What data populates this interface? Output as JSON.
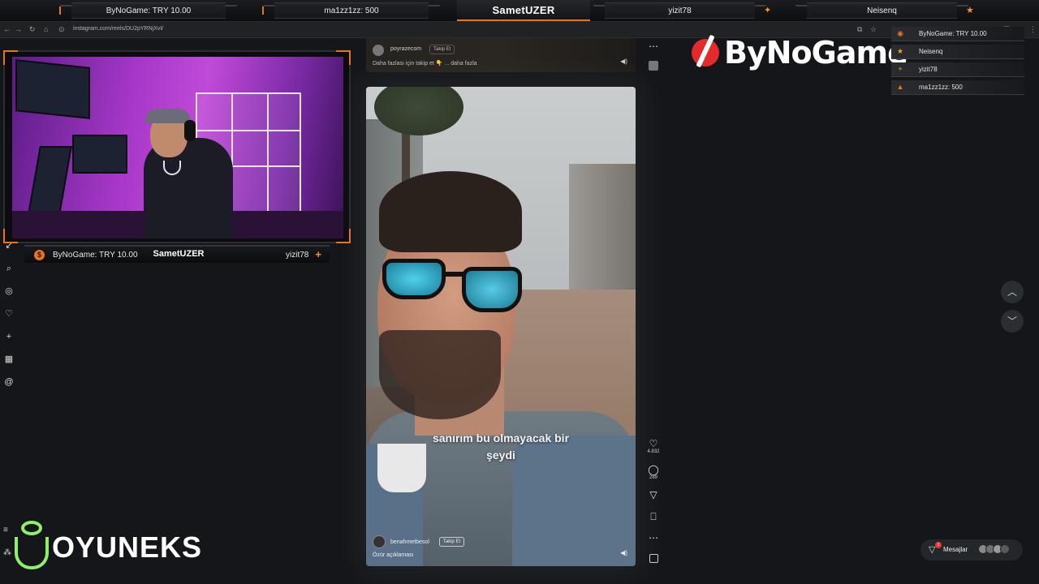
{
  "overlay": {
    "top_slots": [
      "ByNoGame: TRY 10.00",
      "ma1zz1zz: 500",
      "yizit78",
      "Neisenq"
    ],
    "streamer_name": "SametUZER",
    "cam_bar": {
      "left_label": "ByNoGame: TRY 10.00",
      "name": "SametUZER",
      "right_label": "yizit78",
      "coin_symbol": "$",
      "plus_symbol": "+"
    },
    "events": [
      {
        "icon": "coin-icon",
        "icon_glyph": "●",
        "color": "#e8741c",
        "label": "ByNoGame: TRY 10.00"
      },
      {
        "icon": "star-icon",
        "icon_glyph": "★",
        "color": "#f2a51e",
        "label": "Neisenq"
      },
      {
        "icon": "plus-icon",
        "icon_glyph": "+",
        "color": "#f2a51e",
        "label": "yizit78"
      },
      {
        "icon": "flame-icon",
        "icon_glyph": "▲",
        "color": "#e8741c",
        "label": "ma1zz1zz: 500"
      }
    ],
    "logo_text": "ByNoGame",
    "sponsor_text": "OYUNEKS",
    "accent_color": "#e8741c"
  },
  "browser": {
    "url": "instagram.com/reels/DU2pYRNjXvI/"
  },
  "top_post": {
    "username": "poyrazecom",
    "follow_label": "Takip Et",
    "caption": "Daha fazlası için takip et 👇 ... daha fazla"
  },
  "reel": {
    "subtitle_line1": "sanırım bu olmayacak bir",
    "subtitle_line2": "şeydi",
    "username": "benahmetbesol",
    "follow_label": "Takip Et",
    "caption": "Özür açıklaması"
  },
  "actions": {
    "like_count": "4.832",
    "comment_count": "289"
  },
  "messages": {
    "label": "Mesajlar",
    "badge": "1"
  }
}
